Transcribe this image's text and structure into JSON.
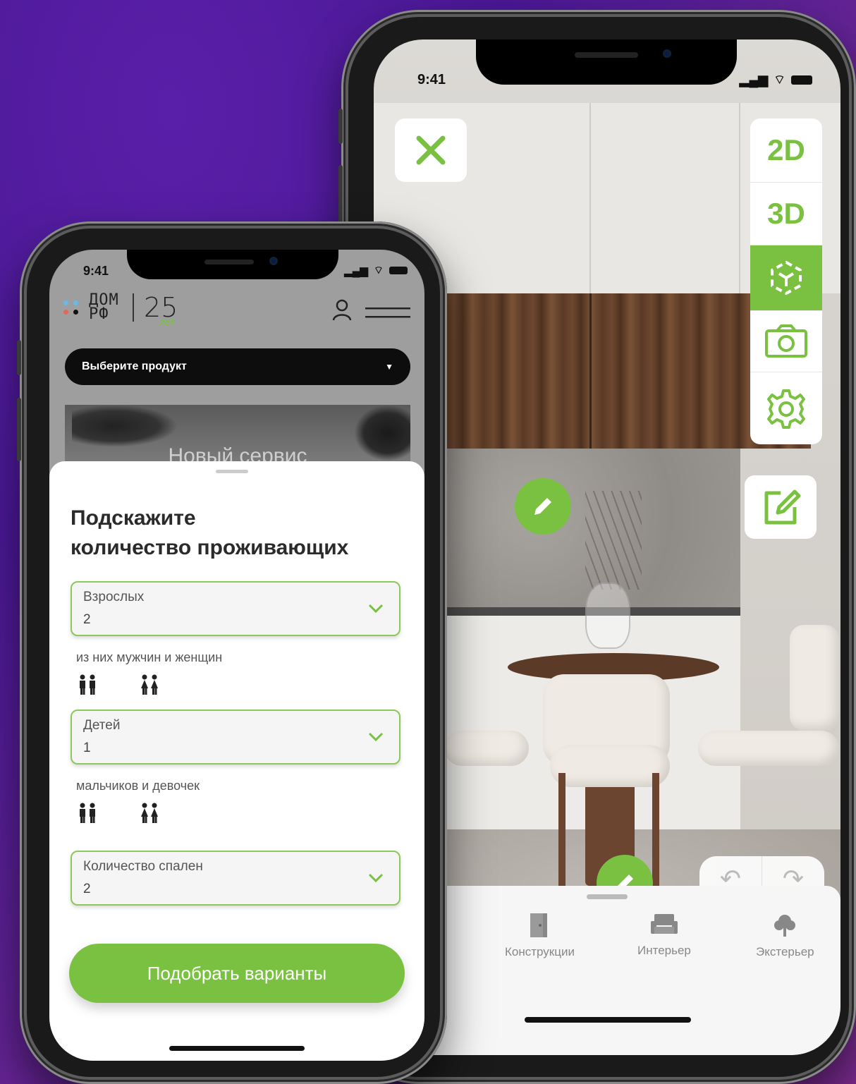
{
  "phone_right": {
    "status_time": "9:41",
    "view_modes": [
      "2D",
      "3D"
    ],
    "undo_icon": "undo-icon",
    "redo_icon": "redo-icon",
    "categories": [
      {
        "label": "Конструкции",
        "icon": "door-icon"
      },
      {
        "label": "Интерьер",
        "icon": "armchair-icon"
      },
      {
        "label": "Экстерьер",
        "icon": "tree-icon"
      }
    ]
  },
  "phone_left": {
    "status_time": "9:41",
    "logo": {
      "main": "ДОМ РФ",
      "number": "25",
      "suffix": "лет"
    },
    "product_select": {
      "label": "Выберите продукт"
    },
    "banner_title": "Новый сервис",
    "sheet": {
      "title_line1": "Подскажите",
      "title_line2": "количество проживающих",
      "adults": {
        "label": "Взрослых",
        "value": "2"
      },
      "adults_sub": "из них мужчин и женщин",
      "children": {
        "label": "Детей",
        "value": "1"
      },
      "children_sub": "мальчиков и девочек",
      "bedrooms": {
        "label": "Количество спален",
        "value": "2"
      },
      "cta": "Подобрать варианты"
    }
  },
  "colors": {
    "accent": "#7ac142",
    "background": "#4a1896"
  }
}
